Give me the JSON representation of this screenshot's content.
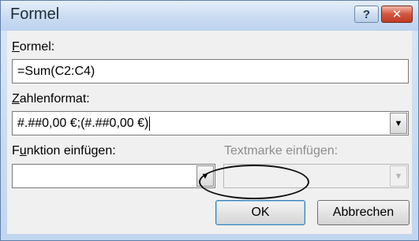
{
  "dialog": {
    "title": "Formel",
    "help_label": "?",
    "close_label": "✕"
  },
  "formula": {
    "label_mnemonic": "F",
    "label_rest": "ormel:",
    "value": "=Sum(C2:C4)"
  },
  "number_format": {
    "label_mnemonic": "Z",
    "label_rest": "ahlenformat:",
    "value": "#.##0,00 €;(#.##0,00 €)"
  },
  "insert_function": {
    "label_pre": "F",
    "label_mnemonic": "u",
    "label_rest": "nktion einfügen:",
    "value": ""
  },
  "insert_bookmark": {
    "label": "Textmarke einfügen:",
    "value": ""
  },
  "buttons": {
    "ok": "OK",
    "cancel": "Abbrechen"
  },
  "icons": {
    "dropdown": "▼"
  }
}
